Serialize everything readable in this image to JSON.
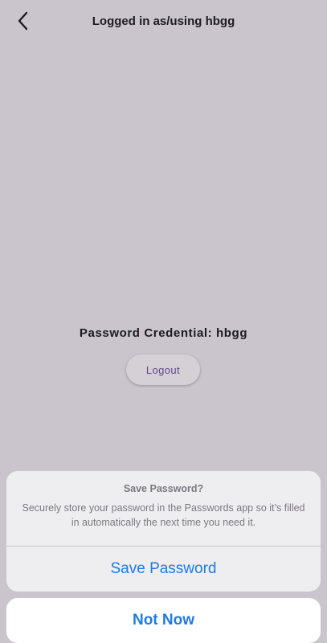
{
  "header": {
    "back_icon": "chevron-left-icon",
    "title": "Logged in as/using hbgg"
  },
  "main": {
    "credential_text": "Password Credential: hbgg",
    "logout_label": "Logout"
  },
  "save_sheet": {
    "title": "Save Password?",
    "message": "Securely store your password in the Passwords app so it’s filled in automatically the next time you need it.",
    "save_label": "Save Password",
    "not_now_label": "Not Now"
  },
  "colors": {
    "background": "#cac5cc",
    "accent_blue": "#1e7ce0",
    "logout_text": "#5b4b8a"
  }
}
